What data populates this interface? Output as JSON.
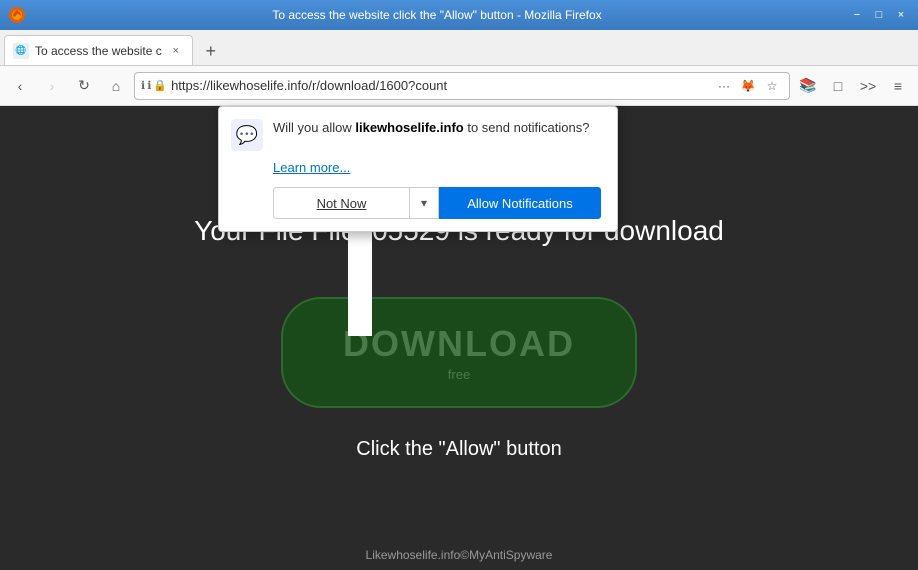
{
  "titlebar": {
    "title": "To access the website click the \"Allow\" button - Mozilla Firefox",
    "min_btn": "−",
    "max_btn": "□",
    "close_btn": "×"
  },
  "tab": {
    "label": "To access the website c",
    "close": "×",
    "new_tab_btn": "+"
  },
  "navbar": {
    "back_btn": "‹",
    "forward_btn": "›",
    "refresh_btn": "↻",
    "home_btn": "⌂",
    "url": "https://likewhoselife.info/r/download/1600?count",
    "more_btn": "···",
    "bookmark_btn": "☆",
    "menu_btn": "≡"
  },
  "popup": {
    "icon": "💬",
    "message": "Will you allow ",
    "site": "likewhoselife.info",
    "message_end": " to send notifications?",
    "learn_more": "Learn more...",
    "not_now_label": "Not Now",
    "dropdown_label": "▾",
    "allow_label": "Allow Notifications"
  },
  "content": {
    "text_top": "Your File File205529 is ready for download",
    "download_text": "DOWNLOAD",
    "download_sub": "free",
    "text_bottom": "Click the \"Allow\" button",
    "footer": "Likewhoselife.info©MyAntiSpyware"
  }
}
